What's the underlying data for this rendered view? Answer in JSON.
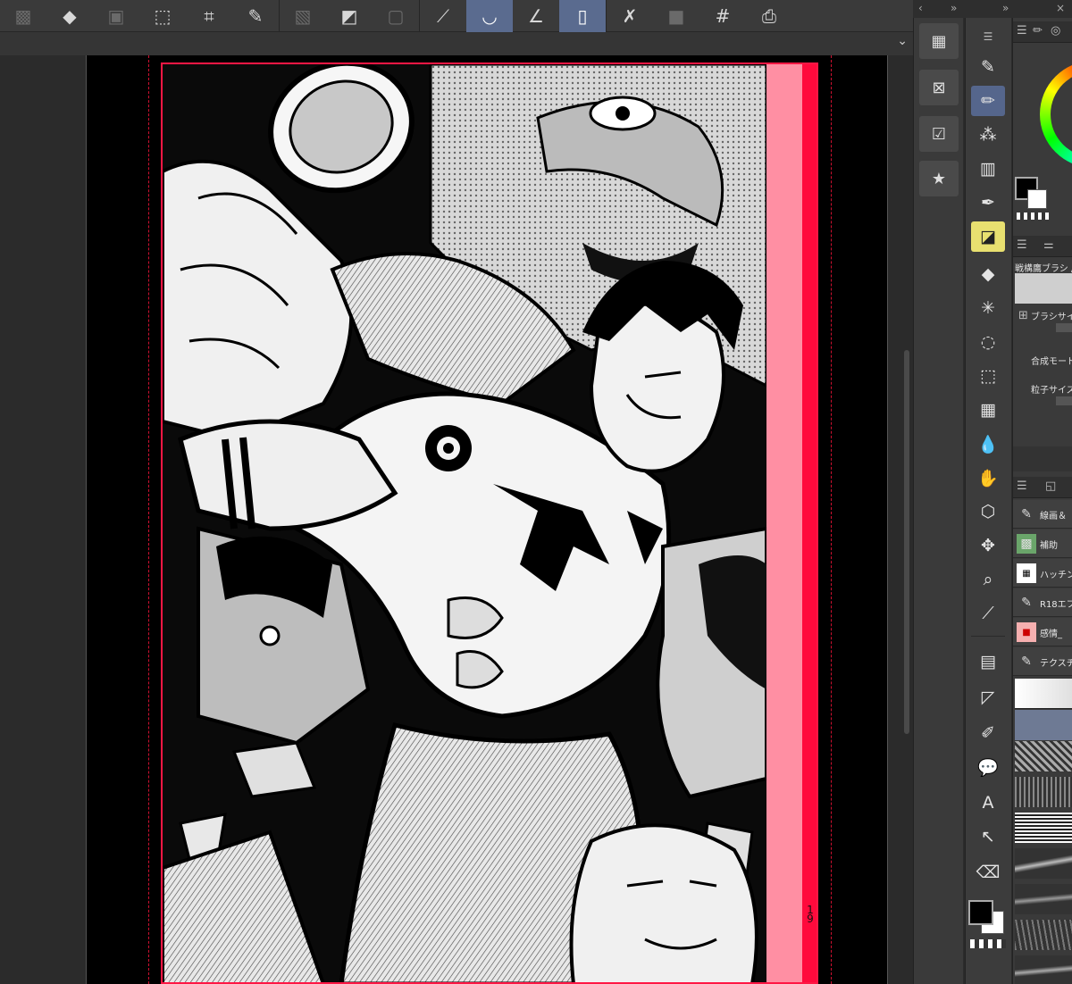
{
  "toolbar": {
    "icons": [
      "selection-icon",
      "fill-icon",
      "transform-icon",
      "free-transform-icon",
      "crop-icon",
      "pen-icon",
      "hatch-icon",
      "tone-icon",
      "frame-icon",
      "ruler-icon",
      "brush-icon",
      "angle-icon",
      "tablet-icon",
      "effect-icon",
      "gradient-icon",
      "grid-icon",
      "print-icon"
    ]
  },
  "panels": {
    "nav_left": "‹",
    "nav_collapse": "»",
    "nav_collapse2": "»",
    "nav_close": "×"
  },
  "right_panel": {
    "brush_name": "戦構鷹ブラシ /",
    "prop_brush_size": "ブラシサイズ",
    "prop_blend_mode": "合成モード",
    "prop_particle_size": "粒子サイズ"
  },
  "layers": [
    {
      "icon": "pen-icon",
      "name": "線画＆"
    },
    {
      "icon": "grid-icon",
      "name": "補助"
    },
    {
      "icon": "hatch-icon",
      "name": "ハッチング"
    },
    {
      "icon": "pen-icon",
      "name": "R18エフ"
    },
    {
      "icon": "red-label-icon",
      "name": "感情_"
    },
    {
      "icon": "pen-icon",
      "name": "テクスチ"
    }
  ],
  "canvas": {
    "page_number": "19"
  },
  "colors": {
    "bleed": "#ff8fa3",
    "frame": "#ff1744",
    "accent": "#55668c"
  }
}
